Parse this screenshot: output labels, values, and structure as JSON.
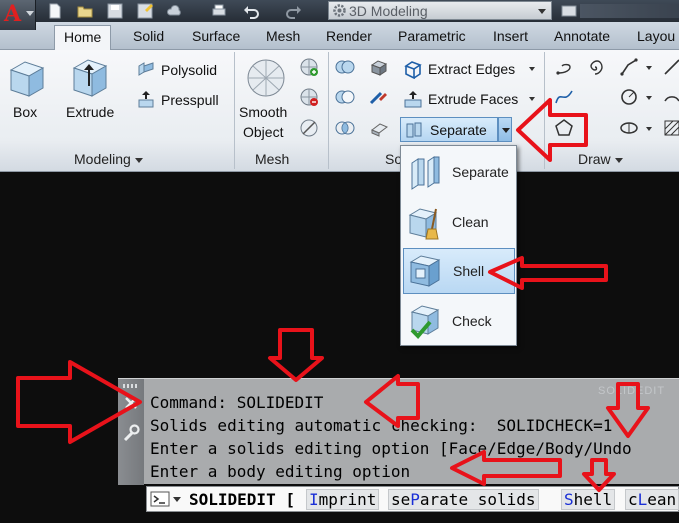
{
  "quick_access": {
    "workspace": "3D Modeling",
    "icons": [
      "new-icon",
      "open-icon",
      "save-icon",
      "save-as-icon",
      "cloud-icon",
      "plot-icon",
      "undo-icon",
      "redo-icon",
      "workspace-gear-icon"
    ]
  },
  "tabs": [
    "Home",
    "Solid",
    "Surface",
    "Mesh",
    "Render",
    "Parametric",
    "Insert",
    "Annotate",
    "Layou"
  ],
  "active_tab": "Home",
  "panels": {
    "modeling": {
      "title": "Modeling",
      "box_label": "Box",
      "extrude_label": "Extrude",
      "polysolid_label": "Polysolid",
      "presspull_label": "Presspull"
    },
    "mesh": {
      "title": "Mesh",
      "smooth_label_1": "Smooth",
      "smooth_label_2": "Object"
    },
    "solid_editing": {
      "title": "So",
      "extract_edges_label": "Extract Edges",
      "extrude_faces_label": "Extrude Faces",
      "separate_label": "Separate"
    },
    "draw": {
      "title": "Draw"
    }
  },
  "dropdown": {
    "items": [
      {
        "label": "Separate",
        "icon": "separate-icon",
        "selected": false
      },
      {
        "label": "Clean",
        "icon": "clean-icon",
        "selected": false
      },
      {
        "label": "Shell",
        "icon": "shell-icon",
        "selected": true
      },
      {
        "label": "Check",
        "icon": "check-icon",
        "selected": false
      }
    ]
  },
  "command_window": {
    "lines": [
      "Command: SOLIDEDIT",
      "Solids editing automatic checking:  SOLIDCHECK=1",
      "Enter a solids editing option [Face/Edge/Body/Undo",
      "Enter a body editing option"
    ],
    "watermark": "SOLIDEDIT",
    "input_text": "SOLIDEDIT [",
    "options": [
      {
        "pre": "",
        "key": "I",
        "post": "mprint"
      },
      {
        "pre": "se",
        "key": "P",
        "post": "arate solids"
      },
      {
        "pre": "",
        "key": "S",
        "post": "hell"
      },
      {
        "pre": "c",
        "key": "L",
        "post": "ean"
      }
    ]
  },
  "colors": {
    "annotation_red": "#e8121a",
    "accent_blue": "#1a2fd6",
    "selected_fill": "#c6e0f7",
    "drawing_area": "#0d0d0d"
  }
}
